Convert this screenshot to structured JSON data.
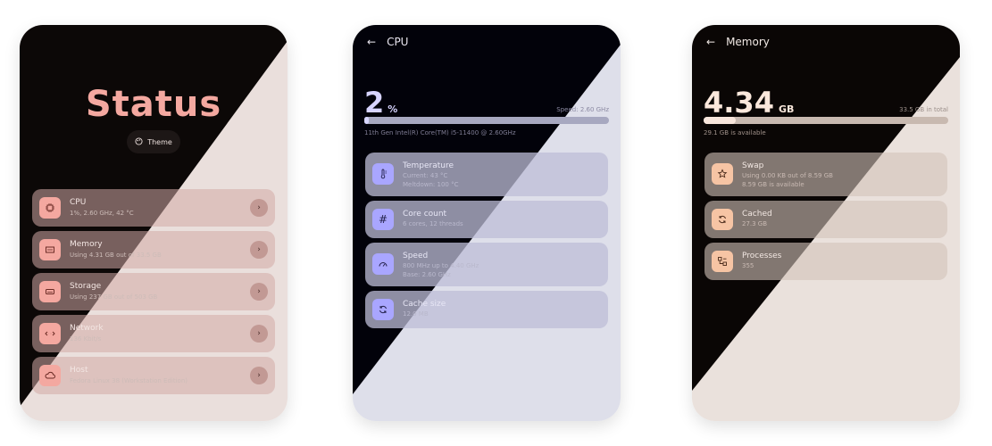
{
  "status": {
    "title": "Status",
    "theme_label": "Theme",
    "items": [
      {
        "label": "CPU",
        "detail": "1%, 2.60 GHz, 42 °C",
        "icon": "cpu-icon"
      },
      {
        "label": "Memory",
        "detail": "Using 4.31 GB out of 33.5 GB",
        "icon": "memory-icon"
      },
      {
        "label": "Storage",
        "detail": "Using 237 GB out of 503 GB",
        "icon": "storage-icon"
      },
      {
        "label": "Network",
        "detail": "136 Kbit/s",
        "icon": "network-icon"
      },
      {
        "label": "Host",
        "detail": "Fedora Linux 38 (Workstation Edition)",
        "icon": "cloud-icon"
      }
    ],
    "chevron": "›",
    "colors": {
      "dark": "#0c0807",
      "light": "#eadfdc",
      "accent": "#f4a8a0"
    }
  },
  "cpu": {
    "title": "CPU",
    "back": "←",
    "value": "2",
    "unit": "%",
    "speed": "Speed: 2.60 GHz",
    "usage_fraction": 0.02,
    "model": "11th Gen Intel(R) Core(TM) i5-11400 @ 2.60GHz",
    "cards": [
      {
        "title": "Temperature",
        "lines": [
          "Current: 43 °C",
          "Meltdown: 100 °C"
        ],
        "icon": "thermometer-icon"
      },
      {
        "title": "Core count",
        "lines": [
          "6 cores, 12 threads"
        ],
        "icon": "hash-icon"
      },
      {
        "title": "Speed",
        "lines": [
          "800 MHz up to 4.40 GHz",
          "Base: 2.60 GHz"
        ],
        "icon": "gauge-icon"
      },
      {
        "title": "Cache size",
        "lines": [
          "12.0 MB"
        ],
        "icon": "refresh-icon"
      }
    ],
    "colors": {
      "dark": "#02020a",
      "light": "#dedfea",
      "accent": "#a9a6ff"
    }
  },
  "memory": {
    "title": "Memory",
    "back": "←",
    "value": "4.34",
    "unit": "GB",
    "total": "33.5 GB in total",
    "usage_fraction": 0.13,
    "available": "29.1 GB is available",
    "cards": [
      {
        "title": "Swap",
        "lines": [
          "Using 0.00 KB out of 8.59 GB",
          "8.59 GB is available"
        ],
        "icon": "swap-icon"
      },
      {
        "title": "Cached",
        "lines": [
          "27.3 GB"
        ],
        "icon": "refresh-icon"
      },
      {
        "title": "Processes",
        "lines": [
          "355"
        ],
        "icon": "processes-icon"
      }
    ],
    "colors": {
      "dark": "#0a0605",
      "light": "#eae1dc",
      "accent": "#f6c4a4"
    }
  }
}
